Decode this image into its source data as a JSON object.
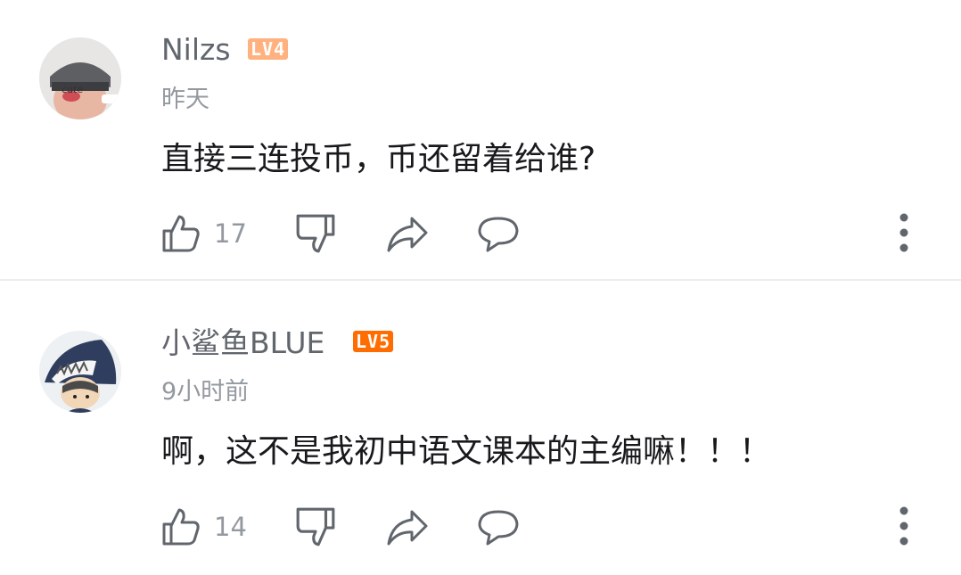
{
  "comments": [
    {
      "username": "Nilzs",
      "level": "LV4",
      "level_color": "#ffb27f",
      "time": "昨天",
      "text": "直接三连投币，币还留着给谁?",
      "likes": "17",
      "avatar_text": "cute"
    },
    {
      "username": "小鲨鱼BLUE",
      "level": "LV5",
      "level_color": "#ff6c00",
      "time": "9小时前",
      "text": "啊，这不是我初中语文课本的主编嘛！！！",
      "likes": "14"
    }
  ],
  "icons": {
    "like": "thumbs-up-icon",
    "dislike": "thumbs-down-icon",
    "share": "share-icon",
    "reply": "reply-icon",
    "more": "more-vertical-icon"
  },
  "colors": {
    "icon": "#61666d",
    "meta": "#9499a0",
    "divider": "#ededed"
  }
}
